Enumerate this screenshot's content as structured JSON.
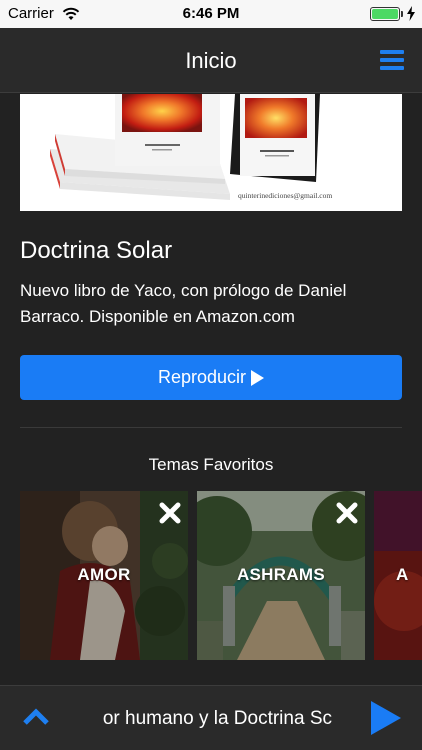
{
  "status_bar": {
    "carrier": "Carrier",
    "time": "6:46 PM"
  },
  "nav": {
    "title": "Inicio",
    "menu_icon": "hamburger-menu-icon"
  },
  "article": {
    "banner_caption": "quinterinediciones@gmail.com",
    "title": "Doctrina Solar",
    "description": "Nuevo libro de Yaco, con prólogo de Daniel Barraco.  Disponible en Amazon.com",
    "play_label": "Reproducir"
  },
  "favorites": {
    "title": "Temas Favoritos",
    "items": [
      {
        "label": "AMOR"
      },
      {
        "label": "ASHRAMS"
      },
      {
        "label": "A"
      }
    ]
  },
  "player": {
    "now_playing": "or humano y la Doctrina Sc"
  },
  "colors": {
    "accent": "#1a7cf5",
    "background": "#222222",
    "bar": "#2a2a2a",
    "battery": "#4cd964"
  }
}
